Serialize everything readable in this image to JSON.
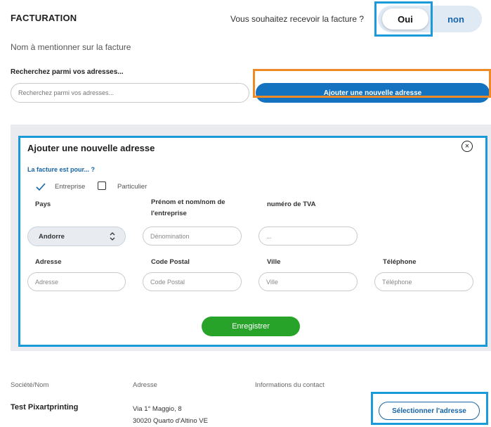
{
  "billing": {
    "title": "FACTURATION",
    "question": "Vous souhaitez recevoir la facture ?",
    "yes_label": "Oui",
    "no_label": "non",
    "name_on_invoice_label": "Nom à mentionner sur la facture"
  },
  "search": {
    "label": "Recherchez parmi vos adresses...",
    "placeholder": "Recherchez parmi vos adresses..."
  },
  "add_address_button": "Ajouter une nouvelle adresse",
  "form": {
    "title": "Ajouter une nouvelle adresse",
    "who_label": "La facture est pour... ?",
    "option_company": "Entreprise",
    "option_private": "Particulier",
    "selected_option": "Entreprise",
    "country_label": "Pays",
    "country_value": "Andorre",
    "name_label": "Prénom et nom/nom de l'entreprise",
    "name_placeholder": "Dénomination",
    "vat_label": "numéro de TVA",
    "vat_placeholder": "...",
    "address_label": "Adresse",
    "address_placeholder": "Adresse",
    "postal_label": "Code Postal",
    "postal_placeholder": "Code Postal",
    "city_label": "Ville",
    "city_placeholder": "Ville",
    "phone_label": "Téléphone",
    "phone_placeholder": "Téléphone",
    "save_button": "Enregistrer"
  },
  "address_list": {
    "headers": [
      "Société/Nom",
      "Adresse",
      "Informations du contact"
    ],
    "rows": [
      {
        "name": "Test Pixartprinting",
        "address_line1": "Via 1° Maggio, 8",
        "address_line2": "30020 Quarto d'Altino VE",
        "contact": "",
        "select_button": "Sélectionner l'adresse"
      }
    ]
  },
  "colors": {
    "primary_blue": "#1473c0",
    "save_green": "#27a32a",
    "highlight_blue": "#1a9ad9",
    "highlight_orange": "#f08a24"
  }
}
